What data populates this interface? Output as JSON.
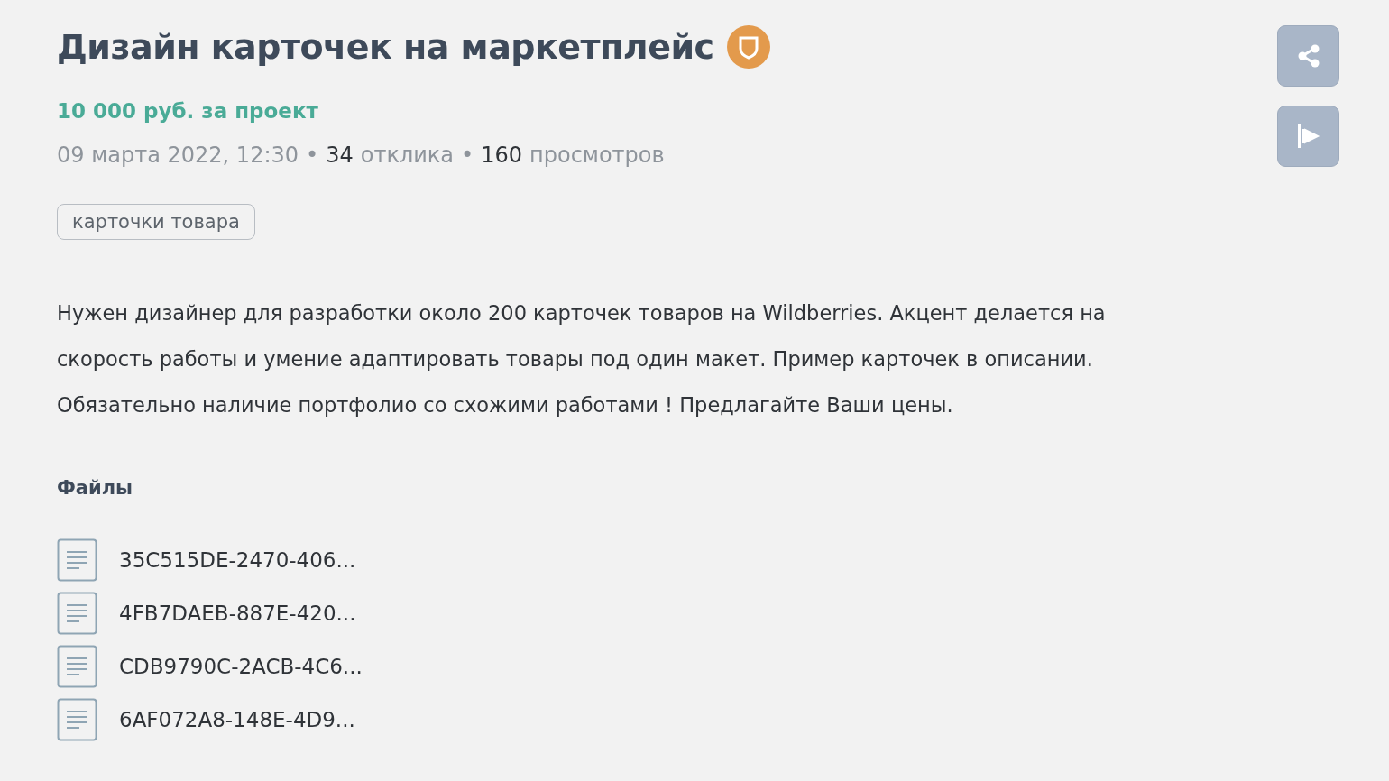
{
  "title": "Дизайн карточек на маркетплейс",
  "price": "10 000 руб. за проект",
  "meta": {
    "date": "09 марта 2022, 12:30",
    "separator": "•",
    "stats": [
      {
        "count": "34",
        "label": "отклика"
      },
      {
        "count": "160",
        "label": "просмотров"
      }
    ]
  },
  "tags": [
    "карточки товара"
  ],
  "description": "Нужен дизайнер для разработки около 200 карточек товаров на Wildberries. Акцент делается на скорость работы и умение адаптировать товары под один макет. Пример карточек в описании. Обязательно наличие портфолио со схожими работами ! Предлагайте Ваши цены.",
  "files_heading": "Файлы",
  "files": [
    "35C515DE-2470-406...",
    "4FB7DAEB-887E-420...",
    "CDB9790C-2ACB-4C6...",
    "6AF072A8-148E-4D9..."
  ]
}
